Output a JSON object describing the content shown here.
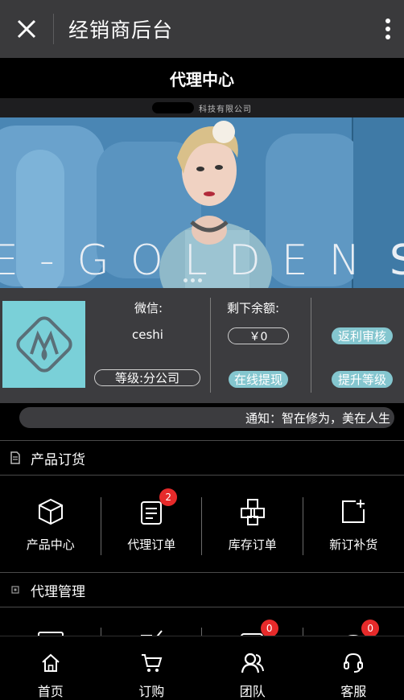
{
  "app_bar": {
    "title": "经销商后台",
    "close_icon": "close-icon",
    "more_icon": "more-vertical-icon"
  },
  "page": {
    "title": "代理中心",
    "company_text": "科技有限公司"
  },
  "banner": {
    "wordmark": "E-GOLDEN",
    "wordmark_next": "S",
    "dots": 3
  },
  "profile": {
    "wechat_label": "微信:",
    "wechat_value": "ceshi",
    "level": "等级:分公司",
    "balance_label": "剩下余额:",
    "balance_value": "￥0",
    "withdraw_button": "在线提现",
    "rebate_button": "返利审核",
    "upgrade_button": "提升等级",
    "accent_color": "#84c6cf"
  },
  "notice": {
    "text": "通知：智在修为，美在人生"
  },
  "sections": {
    "product_order": {
      "title": "产品订货",
      "items": [
        {
          "label": "产品中心",
          "icon": "box-icon",
          "badge": null
        },
        {
          "label": "代理订单",
          "icon": "order-list-icon",
          "badge": "2"
        },
        {
          "label": "库存订单",
          "icon": "stacked-boxes-icon",
          "badge": null
        },
        {
          "label": "新订补货",
          "icon": "add-square-icon",
          "badge": null
        }
      ]
    },
    "agent_management": {
      "title": "代理管理",
      "items": [
        {
          "label": "",
          "icon": "card-icon",
          "badge": null
        },
        {
          "label": "",
          "icon": "edit-icon",
          "badge": null
        },
        {
          "label": "",
          "icon": "message-icon",
          "badge": "0"
        },
        {
          "label": "",
          "icon": "chat-icon",
          "badge": "0"
        }
      ]
    }
  },
  "tab_bar": {
    "items": [
      {
        "label": "首页",
        "icon": "home-icon"
      },
      {
        "label": "订购",
        "icon": "cart-icon"
      },
      {
        "label": "团队",
        "icon": "team-icon"
      },
      {
        "label": "客服",
        "icon": "headset-icon"
      }
    ]
  },
  "badge_color": "#e62a2a"
}
